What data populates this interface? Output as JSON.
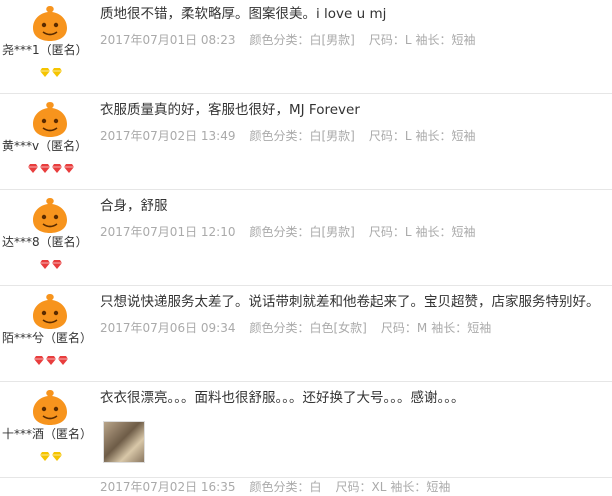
{
  "reviews": [
    {
      "user": "尧***1（匿名）",
      "badge_type": "gold",
      "badge_count": 2,
      "content": "质地很不错，柔软略厚。图案很美。i love u mj",
      "date": "2017年07月01日 08:23",
      "color": "颜色分类：白[男款]",
      "size": "尺码：L",
      "sleeve": "袖长：短袖"
    },
    {
      "user": "黄***v（匿名）",
      "badge_type": "red",
      "badge_count": 4,
      "content": "衣服质量真的好，客服也很好，MJ Forever",
      "date": "2017年07月02日 13:49",
      "color": "颜色分类：白[男款]",
      "size": "尺码：L",
      "sleeve": "袖长：短袖"
    },
    {
      "user": "达***8（匿名）",
      "badge_type": "red",
      "badge_count": 2,
      "content": "合身，舒服",
      "date": "2017年07月01日 12:10",
      "color": "颜色分类：白[男款]",
      "size": "尺码：L",
      "sleeve": "袖长：短袖"
    },
    {
      "user": "陌***兮（匿名）",
      "badge_type": "red",
      "badge_count": 3,
      "content": "只想说快递服务太差了。说话带刺就差和他卷起来了。宝贝超赞，店家服务特别好。",
      "date": "2017年07月06日 09:34",
      "color": "颜色分类：白色[女款]",
      "size": "尺码：M",
      "sleeve": "袖长：短袖"
    },
    {
      "user": "十***酒（匿名）",
      "badge_type": "gold",
      "badge_count": 2,
      "content": "衣衣很漂亮。。。面料也很舒服。。。还好换了大号。。。感谢。。。",
      "date": "2017年07月02日 16:35",
      "color": "颜色分类：白",
      "size": "尺码：XL",
      "sleeve": "袖长：短袖"
    }
  ],
  "colors": {
    "avatar_orange": "#f7941d",
    "badge_gold": "#f5c400",
    "badge_red": "#e83e3e",
    "meta_gray": "#aaaaaa"
  }
}
